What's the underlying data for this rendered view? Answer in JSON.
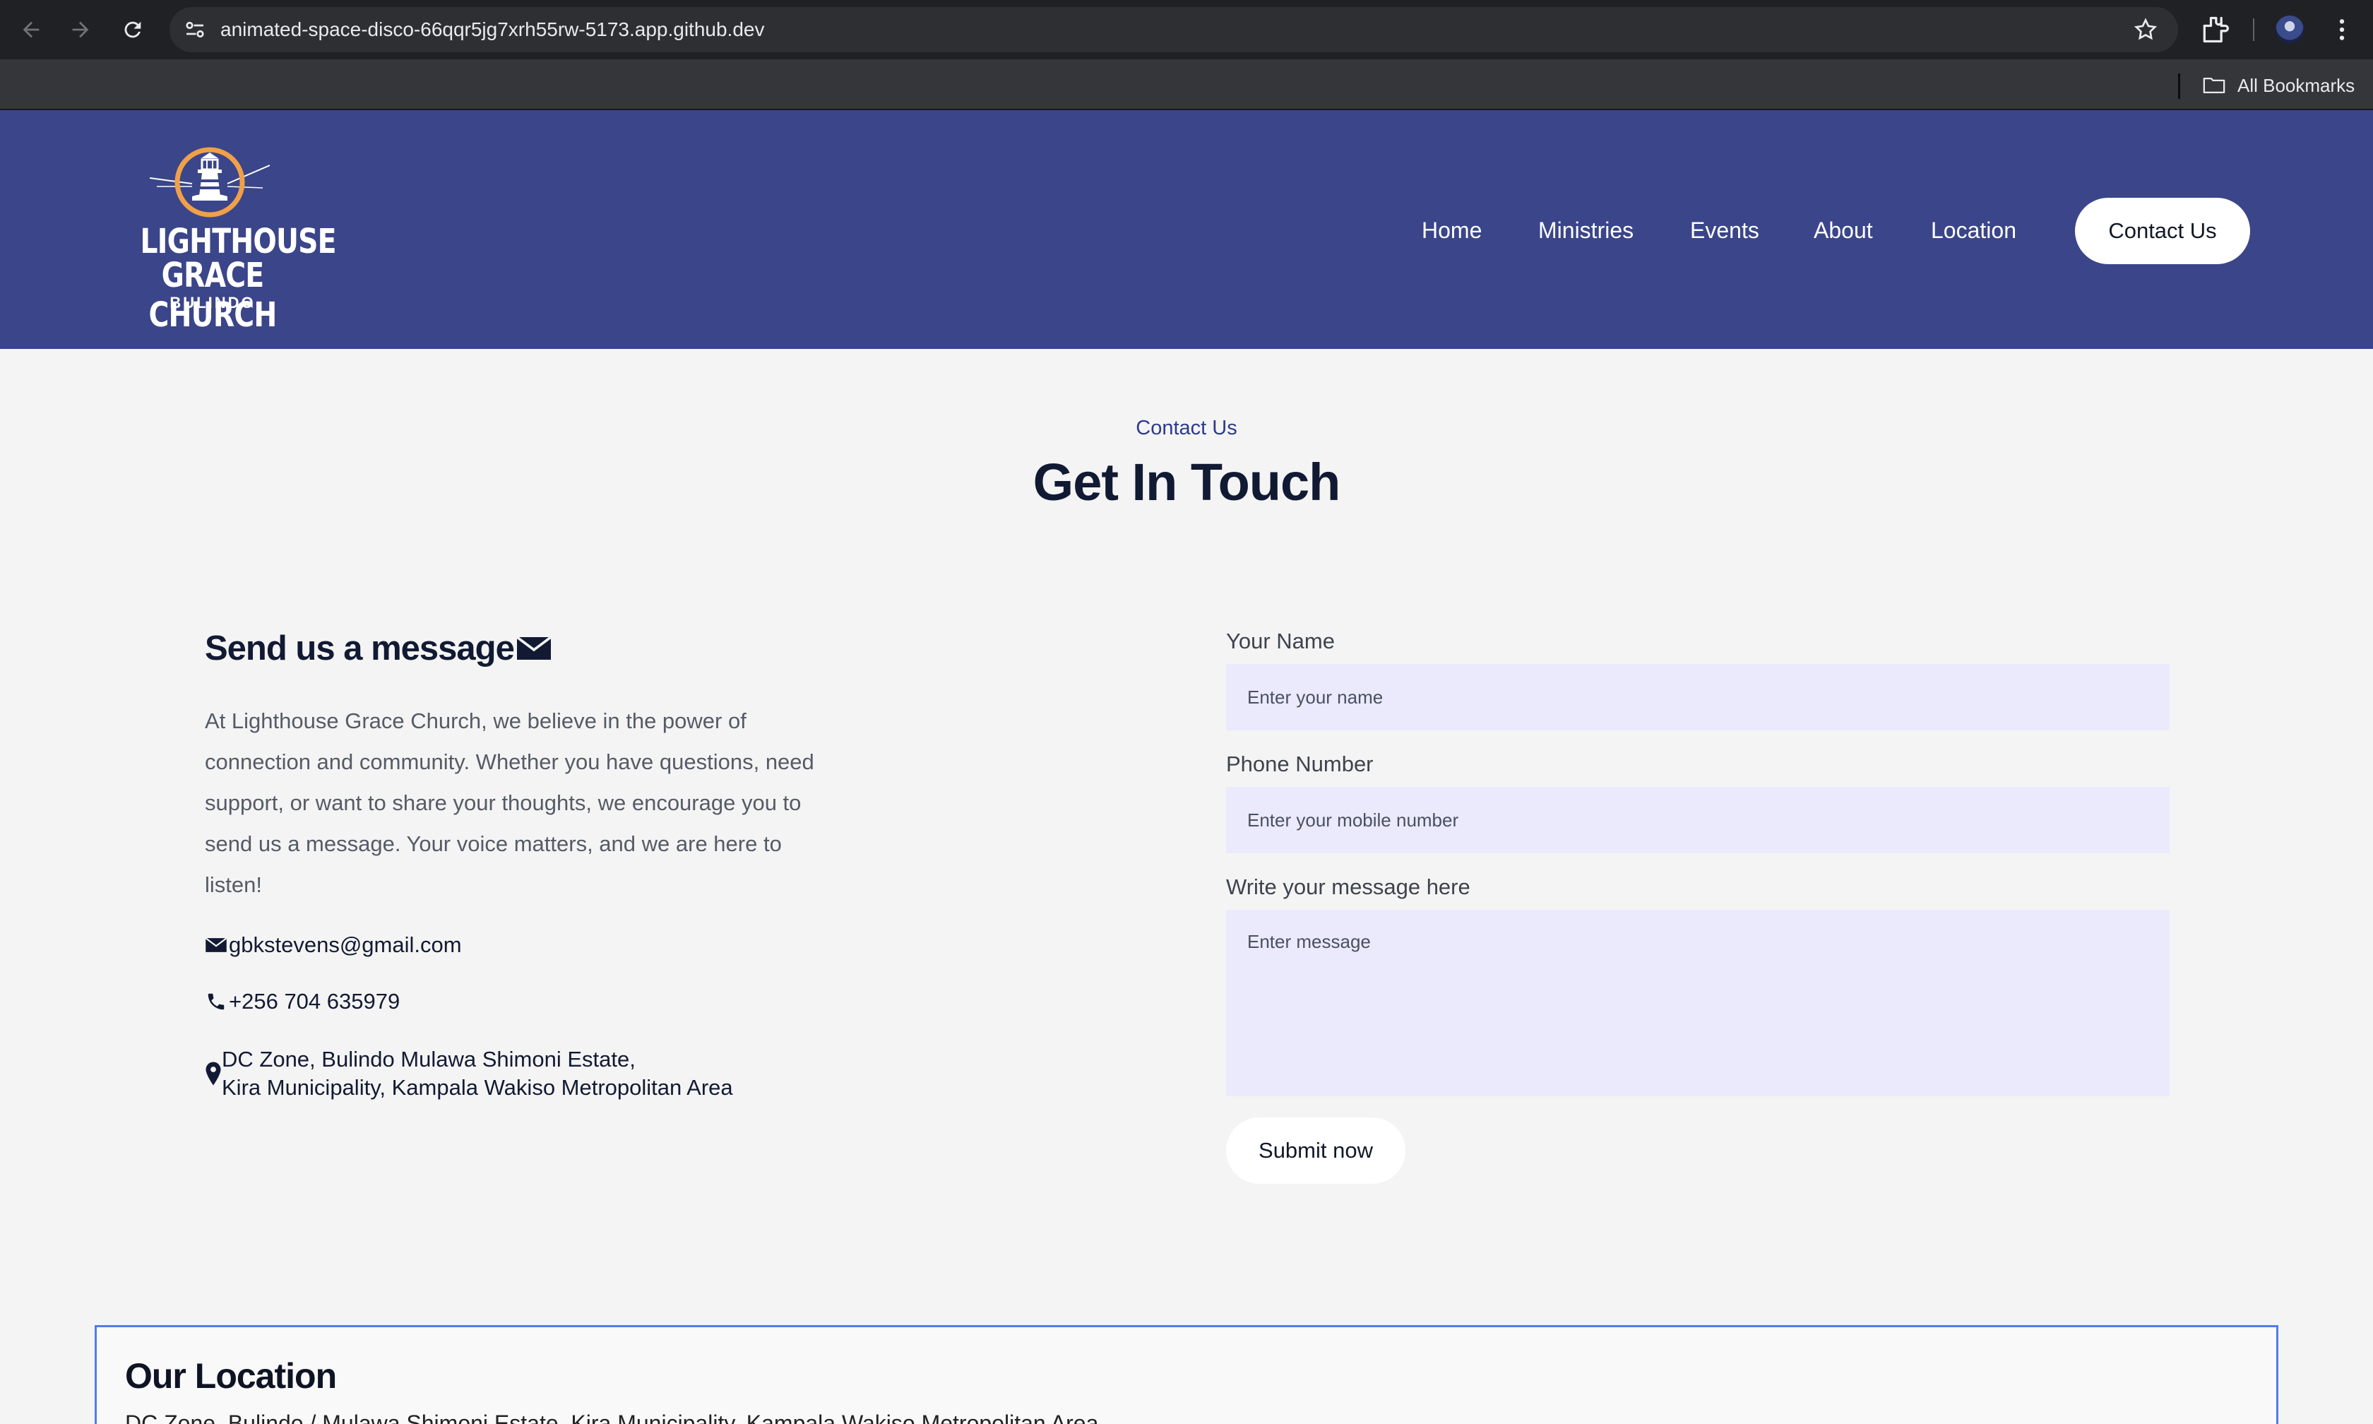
{
  "browser": {
    "url": "animated-space-disco-66qqr5jg7xrh55rw-5173.app.github.dev",
    "bookmarks_label": "All Bookmarks"
  },
  "logo": {
    "line1": "LIGHTHOUSE",
    "line2": "GRACE CHURCH",
    "line3": "BULINDO"
  },
  "nav": {
    "items": [
      "Home",
      "Ministries",
      "Events",
      "About",
      "Location"
    ],
    "cta": "Contact Us"
  },
  "section": {
    "kicker": "Contact Us",
    "title": "Get In Touch"
  },
  "message": {
    "heading": "Send us a message",
    "body": "At Lighthouse Grace Church, we believe in the power of connection and community. Whether you have questions, need support, or want to share your thoughts, we encourage you to send us a message. Your voice matters, and we are here to listen!",
    "email": "gbkstevens@gmail.com",
    "phone": "+256 704 635979",
    "address_line1": "DC Zone, Bulindo Mulawa Shimoni Estate,",
    "address_line2": "Kira Municipality, Kampala Wakiso Metropolitan Area"
  },
  "form": {
    "name_label": "Your Name",
    "name_placeholder": "Enter your name",
    "phone_label": "Phone Number",
    "phone_placeholder": "Enter your mobile number",
    "message_label": "Write your message here",
    "message_placeholder": "Enter message",
    "submit": "Submit now"
  },
  "location": {
    "title": "Our Location",
    "address": "DC Zone, Bulindo / Mulawa Shimoni Estate, Kira Municipality, Kampala Wakiso Metropolitan Area"
  },
  "colors": {
    "header_bg": "#3b4589",
    "page_bg": "#f4f4f4",
    "input_bg": "#eaeafc",
    "accent": "#2d3a8c",
    "logo_orange": "#f0a048"
  }
}
